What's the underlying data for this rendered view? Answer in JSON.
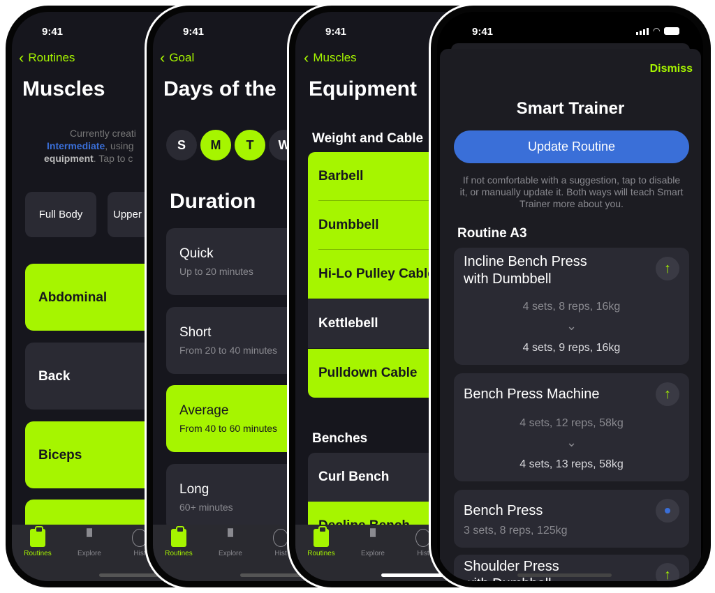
{
  "status_time": "9:41",
  "colors": {
    "accent": "#a6f500",
    "blue": "#3a6fd8",
    "background": "#16161d",
    "card": "#2a2a33"
  },
  "tabbar": {
    "routines": "Routines",
    "explore": "Explore",
    "history": "Hist"
  },
  "screen1": {
    "back": "Routines",
    "title": "Muscles",
    "desc": {
      "line1": "Currently creati",
      "level": "Intermediate",
      "line2_rest": ", using",
      "equipment": "equipment",
      "line3_rest": ". Tap to c"
    },
    "chips": [
      "Full Body",
      "Upper"
    ],
    "muscles": [
      {
        "label": "Abdominal",
        "selected": true
      },
      {
        "label": "Back",
        "selected": false
      },
      {
        "label": "Biceps",
        "selected": true
      },
      {
        "label": "",
        "selected": true
      }
    ]
  },
  "screen2": {
    "back": "Goal",
    "title": "Days of the",
    "days": [
      {
        "label": "S",
        "selected": false
      },
      {
        "label": "M",
        "selected": true
      },
      {
        "label": "T",
        "selected": true
      },
      {
        "label": "W",
        "selected": false
      }
    ],
    "duration_title": "Duration",
    "durations": [
      {
        "title": "Quick",
        "sub": "Up to 20 minutes",
        "selected": false
      },
      {
        "title": "Short",
        "sub": "From 20 to 40 minutes",
        "selected": false
      },
      {
        "title": "Average",
        "sub": "From 40 to 60 minutes",
        "selected": true
      },
      {
        "title": "Long",
        "sub": "60+ minutes",
        "selected": false
      }
    ]
  },
  "screen3": {
    "back": "Muscles",
    "title": "Equipment",
    "section1": "Weight and Cable",
    "items1": [
      {
        "label": "Barbell",
        "selected": true
      },
      {
        "label": "Dumbbell",
        "selected": true
      },
      {
        "label": "Hi-Lo Pulley Cable",
        "selected": true
      },
      {
        "label": "Kettlebell",
        "selected": false
      },
      {
        "label": "Pulldown Cable",
        "selected": true
      }
    ],
    "section2": "Benches",
    "items2": [
      {
        "label": "Curl Bench",
        "selected": false
      },
      {
        "label": "Decline Bench",
        "selected": true
      }
    ]
  },
  "screen4": {
    "dismiss": "Dismiss",
    "title": "Smart Trainer",
    "update_button": "Update Routine",
    "help": "If not comfortable with a suggestion, tap to disable it, or manually update it. Both ways will teach Smart Trainer more about you.",
    "routine": "Routine A3",
    "exercises": [
      {
        "name": "Incline Bench Press\nwith Dumbbell",
        "old": "4 sets, 8 reps, 16kg",
        "new": "4 sets, 9 reps, 16kg",
        "status": "increase"
      },
      {
        "name": "Bench Press Machine",
        "old": "4 sets, 12 reps, 58kg",
        "new": "4 sets, 13 reps, 58kg",
        "status": "increase"
      },
      {
        "name": "Bench Press",
        "current": "3 sets, 8 reps, 125kg",
        "status": "keep"
      },
      {
        "name": "Shoulder Press\nwith Dumbbell",
        "status": "increase"
      }
    ]
  }
}
